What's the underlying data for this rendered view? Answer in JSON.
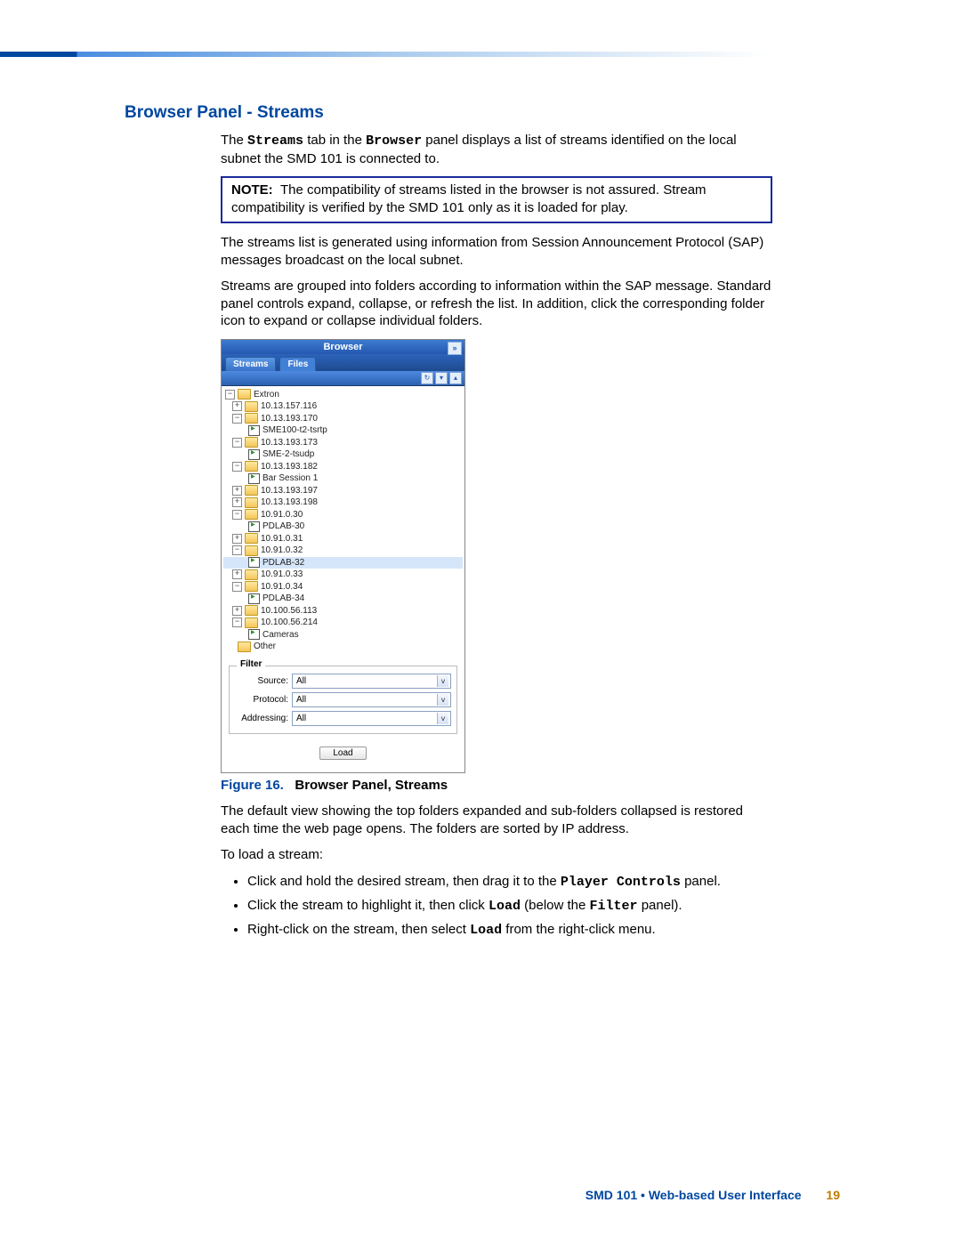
{
  "section_title": "Browser Panel - Streams",
  "intro": {
    "p1a": "The ",
    "p1b": "Streams",
    "p1c": " tab in the ",
    "p1d": "Browser",
    "p1e": " panel displays a list of streams identified on the local subnet the SMD 101 is connected to."
  },
  "note": {
    "label": "NOTE:",
    "text": "The compatibility of streams listed in the browser is not assured. Stream compatibility is verified by the SMD 101 only as it is loaded for play."
  },
  "para2": "The streams list is generated using information from Session Announcement Protocol (SAP) messages broadcast on the local subnet.",
  "para3": "Streams are grouped into folders according to information within the SAP message. Standard panel controls expand, collapse, or refresh the list. In addition, click the corresponding folder icon to expand or collapse individual folders.",
  "panel": {
    "title": "Browser",
    "tab_streams": "Streams",
    "tab_files": "Files",
    "tree": [
      {
        "lvl": 0,
        "exp": "−",
        "icon": "fld",
        "label": "Extron"
      },
      {
        "lvl": 1,
        "exp": "+",
        "icon": "fld",
        "label": "10.13.157.116"
      },
      {
        "lvl": 1,
        "exp": "−",
        "icon": "fld",
        "label": "10.13.193.170"
      },
      {
        "lvl": 2,
        "icon": "strm",
        "label": "SME100-t2-tsrtp"
      },
      {
        "lvl": 1,
        "exp": "−",
        "icon": "fld",
        "label": "10.13.193.173"
      },
      {
        "lvl": 2,
        "icon": "strm",
        "label": "SME-2-tsudp"
      },
      {
        "lvl": 1,
        "exp": "−",
        "icon": "fld",
        "label": "10.13.193.182"
      },
      {
        "lvl": 2,
        "icon": "strm",
        "label": "Bar Session 1"
      },
      {
        "lvl": 1,
        "exp": "+",
        "icon": "fld",
        "label": "10.13.193.197"
      },
      {
        "lvl": 1,
        "exp": "+",
        "icon": "fld",
        "label": "10.13.193.198"
      },
      {
        "lvl": 1,
        "exp": "−",
        "icon": "fld",
        "label": "10.91.0.30"
      },
      {
        "lvl": 2,
        "icon": "strm",
        "label": "PDLAB-30"
      },
      {
        "lvl": 1,
        "exp": "+",
        "icon": "fld",
        "label": "10.91.0.31"
      },
      {
        "lvl": 1,
        "exp": "−",
        "icon": "fld",
        "label": "10.91.0.32"
      },
      {
        "lvl": 2,
        "icon": "strm",
        "label": "PDLAB-32",
        "hl": true
      },
      {
        "lvl": 1,
        "exp": "+",
        "icon": "fld",
        "label": "10.91.0.33"
      },
      {
        "lvl": 1,
        "exp": "−",
        "icon": "fld",
        "label": "10.91.0.34"
      },
      {
        "lvl": 2,
        "icon": "strm",
        "label": "PDLAB-34"
      },
      {
        "lvl": 1,
        "exp": "+",
        "icon": "fld",
        "label": "10.100.56.113"
      },
      {
        "lvl": 1,
        "exp": "−",
        "icon": "fld",
        "label": "10.100.56.214"
      },
      {
        "lvl": 2,
        "icon": "strm",
        "label": "Cameras"
      },
      {
        "lvl": 0,
        "icon": "fld",
        "label": "Other"
      }
    ],
    "filter": {
      "legend": "Filter",
      "source_label": "Source:",
      "source_value": "All",
      "protocol_label": "Protocol:",
      "protocol_value": "All",
      "addressing_label": "Addressing:",
      "addressing_value": "All"
    },
    "load_button": "Load"
  },
  "figure": {
    "num": "Figure 16.",
    "caption": "Browser Panel, Streams"
  },
  "para4": "The default view showing the top folders expanded and sub-folders collapsed is restored each time the web page opens. The folders are sorted by IP address.",
  "para5": "To load a stream:",
  "bullets": {
    "b1a": "Click and hold the desired stream, then drag it to the ",
    "b1b": "Player Controls",
    "b1c": " panel.",
    "b2a": "Click the stream to highlight it, then click ",
    "b2b": "Load",
    "b2c": " (below the ",
    "b2d": "Filter",
    "b2e": " panel).",
    "b3a": "Right-click on the stream, then select ",
    "b3b": "Load",
    "b3c": " from the right-click menu."
  },
  "footer": {
    "text": "SMD 101 • Web-based User Interface",
    "page": "19"
  }
}
